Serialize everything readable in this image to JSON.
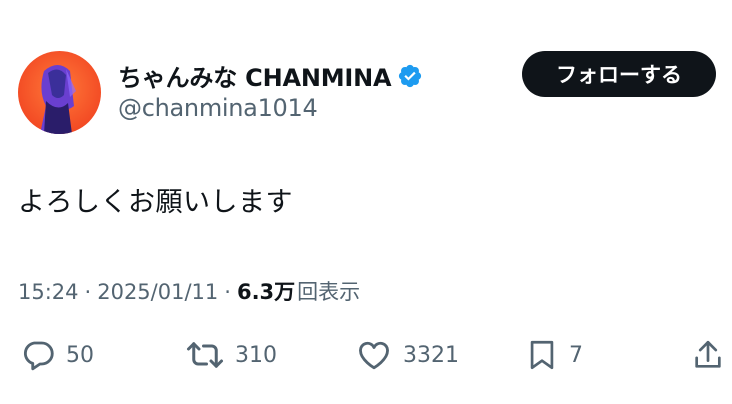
{
  "user": {
    "display_name": "ちゃんみな CHANMINA",
    "handle": "@chanmina1014",
    "verified_icon": "verified-badge-icon",
    "avatar_icon": "avatar-photo"
  },
  "follow_button": {
    "label": "フォローする"
  },
  "tweet": {
    "text": "よろしくお願いします"
  },
  "meta": {
    "time": "15:24",
    "separator": "·",
    "date": "2025/01/11",
    "views_count": "6.3万",
    "views_label": "回表示"
  },
  "actions": {
    "reply": {
      "icon": "reply-icon",
      "count": "50"
    },
    "retweet": {
      "icon": "retweet-icon",
      "count": "310"
    },
    "like": {
      "icon": "heart-icon",
      "count": "3321"
    },
    "bookmark": {
      "icon": "bookmark-icon",
      "count": "7"
    },
    "share": {
      "icon": "share-icon"
    }
  },
  "colors": {
    "text": "#0f1419",
    "secondary": "#536471",
    "verified": "#1d9bf0",
    "button_bg": "#0f1419",
    "avatar_bg": "#ff5a2c"
  }
}
